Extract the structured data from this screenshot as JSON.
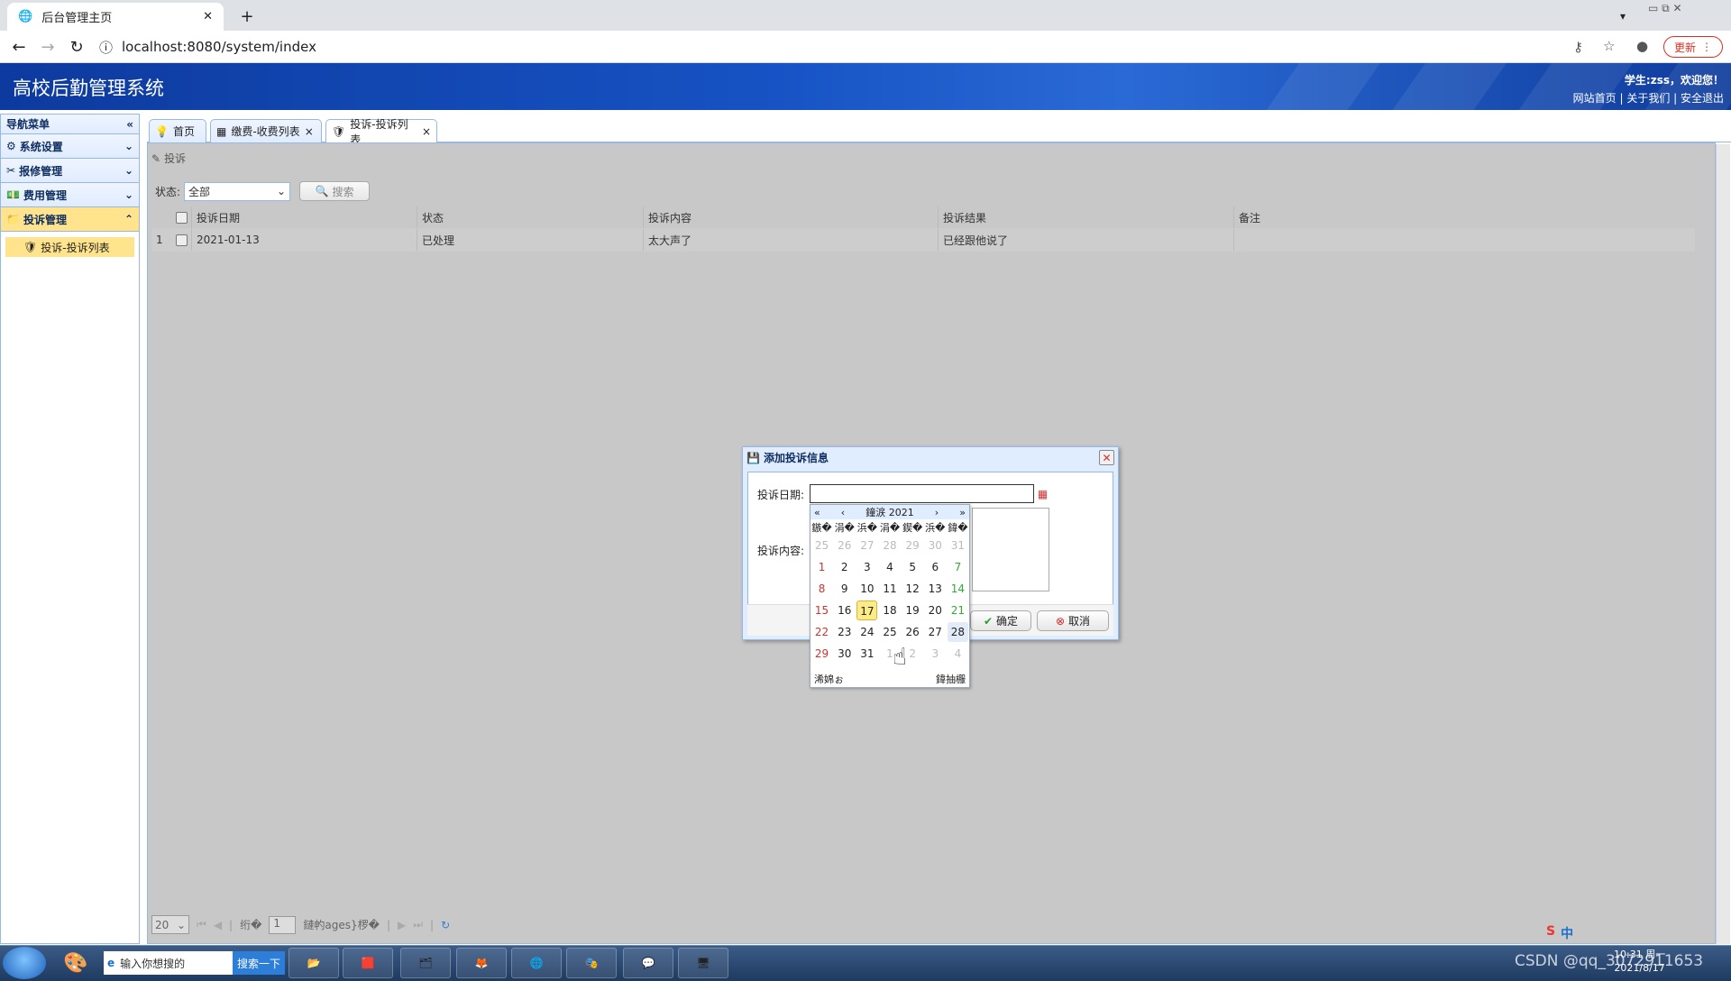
{
  "browser": {
    "tab_title": "后台管理主页",
    "url": "localhost:8080/system/index",
    "update_label": "更新"
  },
  "header": {
    "title": "高校后勤管理系统",
    "welcome": "学生:zss，欢迎您！",
    "links": "网站首页 | 关于我们 | 安全退出",
    "color": "#1753c4"
  },
  "sidebar": {
    "title": "导航菜单",
    "items": [
      {
        "label": "系统设置",
        "icon": "gear-icon"
      },
      {
        "label": "报修管理",
        "icon": "tools-icon"
      },
      {
        "label": "费用管理",
        "icon": "money-icon"
      },
      {
        "label": "投诉管理",
        "icon": "folder-icon"
      }
    ],
    "sub_item": "投诉-投诉列表"
  },
  "tabs": [
    {
      "label": "首页"
    },
    {
      "label": "缴费-收费列表"
    },
    {
      "label": "投诉-投诉列表"
    }
  ],
  "panel": {
    "title": "投诉",
    "status_label": "状态:",
    "status_value": "全部",
    "search_label": "搜索"
  },
  "grid": {
    "columns": [
      "投诉日期",
      "状态",
      "投诉内容",
      "投诉结果",
      "备注"
    ],
    "rows": [
      {
        "num": "1",
        "date": "2021-01-13",
        "status": "已处理",
        "content": "太大声了",
        "result": "已经跟他说了",
        "note": ""
      }
    ]
  },
  "pager": {
    "page_size": "20",
    "page_prefix": "绗�",
    "page_value": "1",
    "page_suffix": "鏈畃ages}椤�"
  },
  "dialog": {
    "title": "添加投诉信息",
    "date_label": "投诉日期:",
    "content_label": "投诉内容:",
    "ok_label": "确定",
    "cancel_label": "取消"
  },
  "calendar": {
    "header": "鐘涙 2021",
    "weekdays": [
      "鏃�",
      "涓�",
      "浜�",
      "涓�",
      "鍥�",
      "浜�",
      "鍏�"
    ],
    "footer_left": "浠婂ぉ",
    "footer_right": "鍏抽棴",
    "days": [
      {
        "d": "25",
        "t": "other"
      },
      {
        "d": "26",
        "t": "other"
      },
      {
        "d": "27",
        "t": "other"
      },
      {
        "d": "28",
        "t": "other"
      },
      {
        "d": "29",
        "t": "other"
      },
      {
        "d": "30",
        "t": "other"
      },
      {
        "d": "31",
        "t": "other"
      },
      {
        "d": "1",
        "t": "sun"
      },
      {
        "d": "2",
        "t": ""
      },
      {
        "d": "3",
        "t": ""
      },
      {
        "d": "4",
        "t": ""
      },
      {
        "d": "5",
        "t": ""
      },
      {
        "d": "6",
        "t": ""
      },
      {
        "d": "7",
        "t": "sat"
      },
      {
        "d": "8",
        "t": "sun"
      },
      {
        "d": "9",
        "t": ""
      },
      {
        "d": "10",
        "t": ""
      },
      {
        "d": "11",
        "t": ""
      },
      {
        "d": "12",
        "t": ""
      },
      {
        "d": "13",
        "t": ""
      },
      {
        "d": "14",
        "t": "sat"
      },
      {
        "d": "15",
        "t": "sun"
      },
      {
        "d": "16",
        "t": ""
      },
      {
        "d": "17",
        "t": "today"
      },
      {
        "d": "18",
        "t": ""
      },
      {
        "d": "19",
        "t": ""
      },
      {
        "d": "20",
        "t": ""
      },
      {
        "d": "21",
        "t": "sat"
      },
      {
        "d": "22",
        "t": "sun"
      },
      {
        "d": "23",
        "t": ""
      },
      {
        "d": "24",
        "t": ""
      },
      {
        "d": "25",
        "t": ""
      },
      {
        "d": "26",
        "t": ""
      },
      {
        "d": "27",
        "t": ""
      },
      {
        "d": "28",
        "t": "hover"
      },
      {
        "d": "29",
        "t": "sun"
      },
      {
        "d": "30",
        "t": ""
      },
      {
        "d": "31",
        "t": ""
      },
      {
        "d": "1",
        "t": "other"
      },
      {
        "d": "2",
        "t": "other"
      },
      {
        "d": "3",
        "t": "other"
      },
      {
        "d": "4",
        "t": "other"
      }
    ]
  },
  "taskbar": {
    "search_placeholder": "输入你想搜的",
    "search_button": "搜索一下",
    "clock_time": "10:31 周一",
    "clock_date": "2021/8/17",
    "watermark": "CSDN @qq_3072911653",
    "ime": "中"
  }
}
